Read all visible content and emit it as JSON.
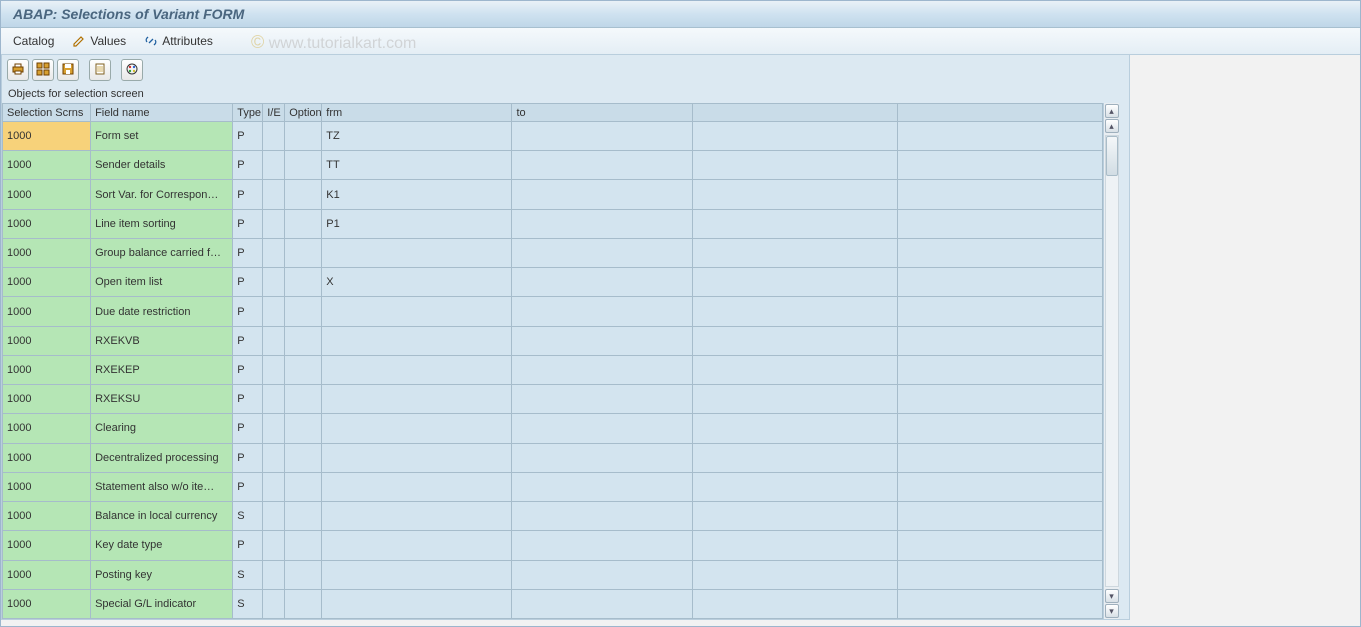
{
  "title": "ABAP: Selections of Variant FORM",
  "toolbar": {
    "catalog": "Catalog",
    "values": "Values",
    "attributes": "Attributes"
  },
  "watermark": "www.tutorialkart.com",
  "section_label": "Objects for selection screen",
  "columns": {
    "scrn": "Selection Scrns",
    "field": "Field name",
    "type": "Type",
    "ie": "I/E",
    "option": "Option",
    "frm": "frm",
    "to": "to"
  },
  "rows": [
    {
      "scrn": "1000",
      "field": "Form set",
      "type": "P",
      "ie": "",
      "opt": "",
      "frm": "TZ",
      "to": "",
      "selected": true
    },
    {
      "scrn": "1000",
      "field": "Sender details",
      "type": "P",
      "ie": "",
      "opt": "",
      "frm": "TT",
      "to": ""
    },
    {
      "scrn": "1000",
      "field": "Sort Var. for Correspon…",
      "type": "P",
      "ie": "",
      "opt": "",
      "frm": "K1",
      "to": ""
    },
    {
      "scrn": "1000",
      "field": "Line item sorting",
      "type": "P",
      "ie": "",
      "opt": "",
      "frm": "P1",
      "to": ""
    },
    {
      "scrn": "1000",
      "field": "Group balance carried f…",
      "type": "P",
      "ie": "",
      "opt": "",
      "frm": "",
      "to": ""
    },
    {
      "scrn": "1000",
      "field": "Open item list",
      "type": "P",
      "ie": "",
      "opt": "",
      "frm": "X",
      "to": ""
    },
    {
      "scrn": "1000",
      "field": "Due date restriction",
      "type": "P",
      "ie": "",
      "opt": "",
      "frm": "",
      "to": ""
    },
    {
      "scrn": "1000",
      "field": "RXEKVB",
      "type": "P",
      "ie": "",
      "opt": "",
      "frm": "",
      "to": ""
    },
    {
      "scrn": "1000",
      "field": "RXEKEP",
      "type": "P",
      "ie": "",
      "opt": "",
      "frm": "",
      "to": ""
    },
    {
      "scrn": "1000",
      "field": "RXEKSU",
      "type": "P",
      "ie": "",
      "opt": "",
      "frm": "",
      "to": ""
    },
    {
      "scrn": "1000",
      "field": "Clearing",
      "type": "P",
      "ie": "",
      "opt": "",
      "frm": "",
      "to": ""
    },
    {
      "scrn": "1000",
      "field": "Decentralized processing",
      "type": "P",
      "ie": "",
      "opt": "",
      "frm": "",
      "to": ""
    },
    {
      "scrn": "1000",
      "field": "Statement also w/o ite…",
      "type": "P",
      "ie": "",
      "opt": "",
      "frm": "",
      "to": ""
    },
    {
      "scrn": "1000",
      "field": "Balance in local currency",
      "type": "S",
      "ie": "",
      "opt": "",
      "frm": "",
      "to": ""
    },
    {
      "scrn": "1000",
      "field": "Key date type",
      "type": "P",
      "ie": "",
      "opt": "",
      "frm": "",
      "to": ""
    },
    {
      "scrn": "1000",
      "field": "Posting key",
      "type": "S",
      "ie": "",
      "opt": "",
      "frm": "",
      "to": ""
    },
    {
      "scrn": "1000",
      "field": "Special G/L indicator",
      "type": "S",
      "ie": "",
      "opt": "",
      "frm": "",
      "to": ""
    }
  ],
  "icons": {
    "print": "print-icon",
    "select_all": "select-all-icon",
    "save": "save-icon",
    "page": "page-icon",
    "palette": "palette-icon",
    "pencil": "pencil-icon",
    "link": "link-icon"
  }
}
